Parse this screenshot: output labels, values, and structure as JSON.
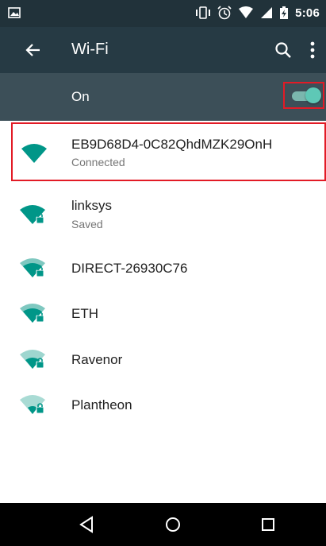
{
  "status_bar": {
    "time": "5:06"
  },
  "app_bar": {
    "title": "Wi-Fi"
  },
  "wifi_toggle": {
    "label": "On",
    "state": "on"
  },
  "networks": [
    {
      "name": "EB9D68D4-0C82QhdMZK29OnH",
      "status": "Connected",
      "locked": false,
      "signal": 1.0
    },
    {
      "name": "linksys",
      "status": "Saved",
      "locked": true,
      "signal": 1.0
    },
    {
      "name": "DIRECT-26930C76",
      "status": "",
      "locked": true,
      "signal": 0.8
    },
    {
      "name": "ETH",
      "status": "",
      "locked": true,
      "signal": 0.8
    },
    {
      "name": "Ravenor",
      "status": "",
      "locked": true,
      "signal": 0.55
    },
    {
      "name": "Plantheon",
      "status": "",
      "locked": true,
      "signal": 0.4
    }
  ],
  "colors": {
    "status_bar": "#21323a",
    "app_bar": "#263a44",
    "toggle_bar": "#3c4f58",
    "accent": "#009688",
    "highlight": "#e21b26"
  }
}
